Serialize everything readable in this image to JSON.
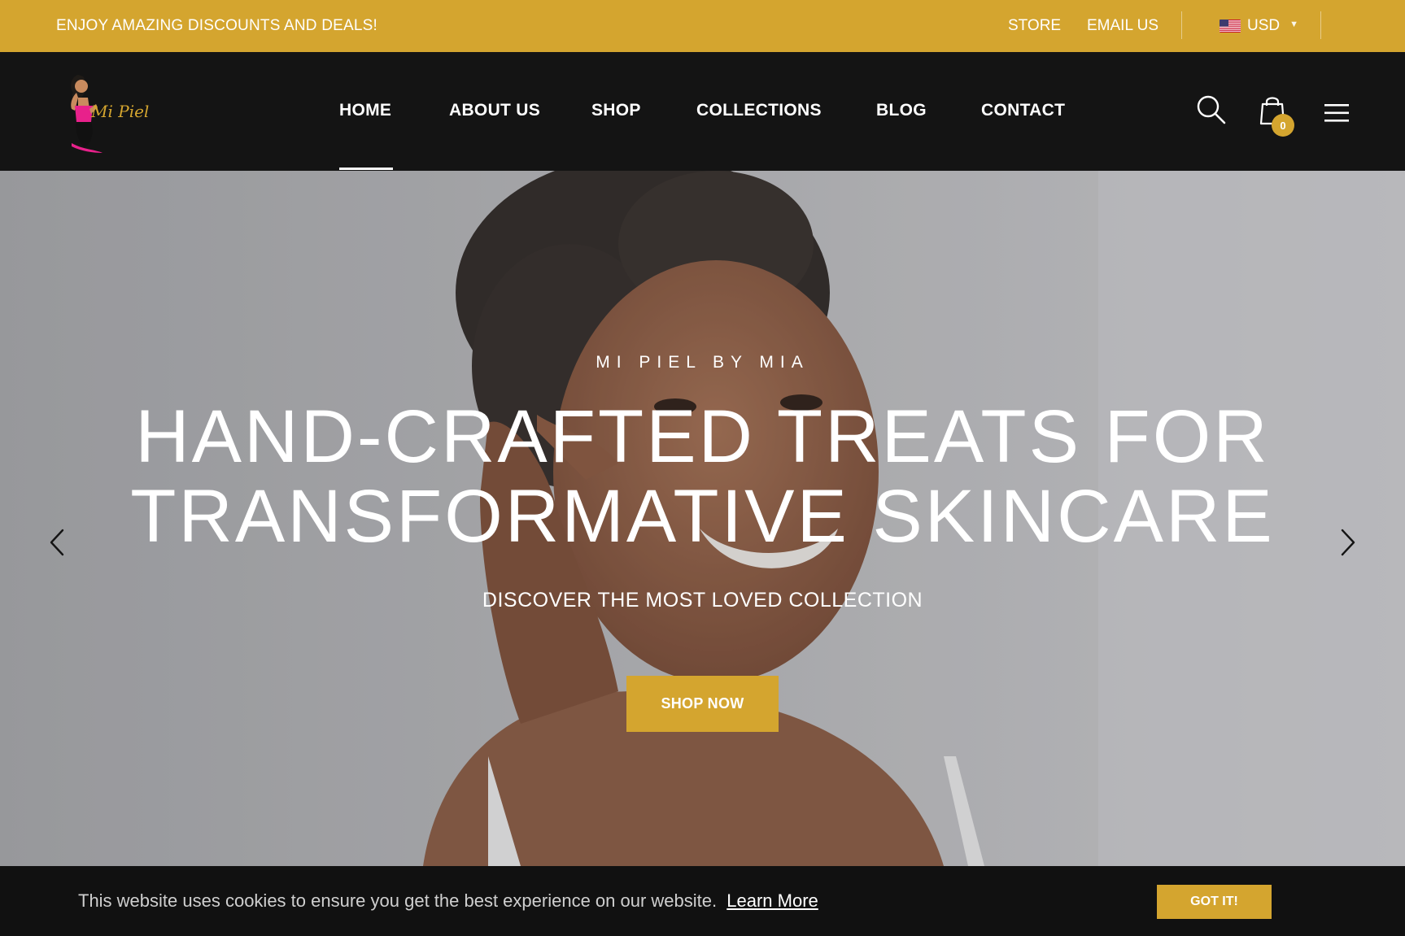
{
  "topbar": {
    "announcement": "ENJOY AMAZING DISCOUNTS AND DEALS!",
    "links": {
      "store": "STORE",
      "email": "EMAIL US"
    },
    "currency": "USD"
  },
  "header": {
    "logo_text": "Mi Piel",
    "nav": [
      "HOME",
      "ABOUT US",
      "SHOP",
      "COLLECTIONS",
      "BLOG",
      "CONTACT"
    ],
    "cart_count": "0"
  },
  "hero": {
    "eyebrow": "MI PIEL BY MIA",
    "headline_line1": "HAND-CRAFTED TREATS FOR",
    "headline_line2": "TRANSFORMATIVE SKINCARE",
    "subhead": "DISCOVER THE MOST LOVED COLLECTION",
    "cta": "SHOP NOW"
  },
  "cookie": {
    "message": "This website uses cookies to ensure you get the best experience on our website.",
    "learn_more": "Learn More",
    "accept": "GOT IT!"
  },
  "colors": {
    "accent": "#d4a52f",
    "header_bg": "#141414"
  }
}
